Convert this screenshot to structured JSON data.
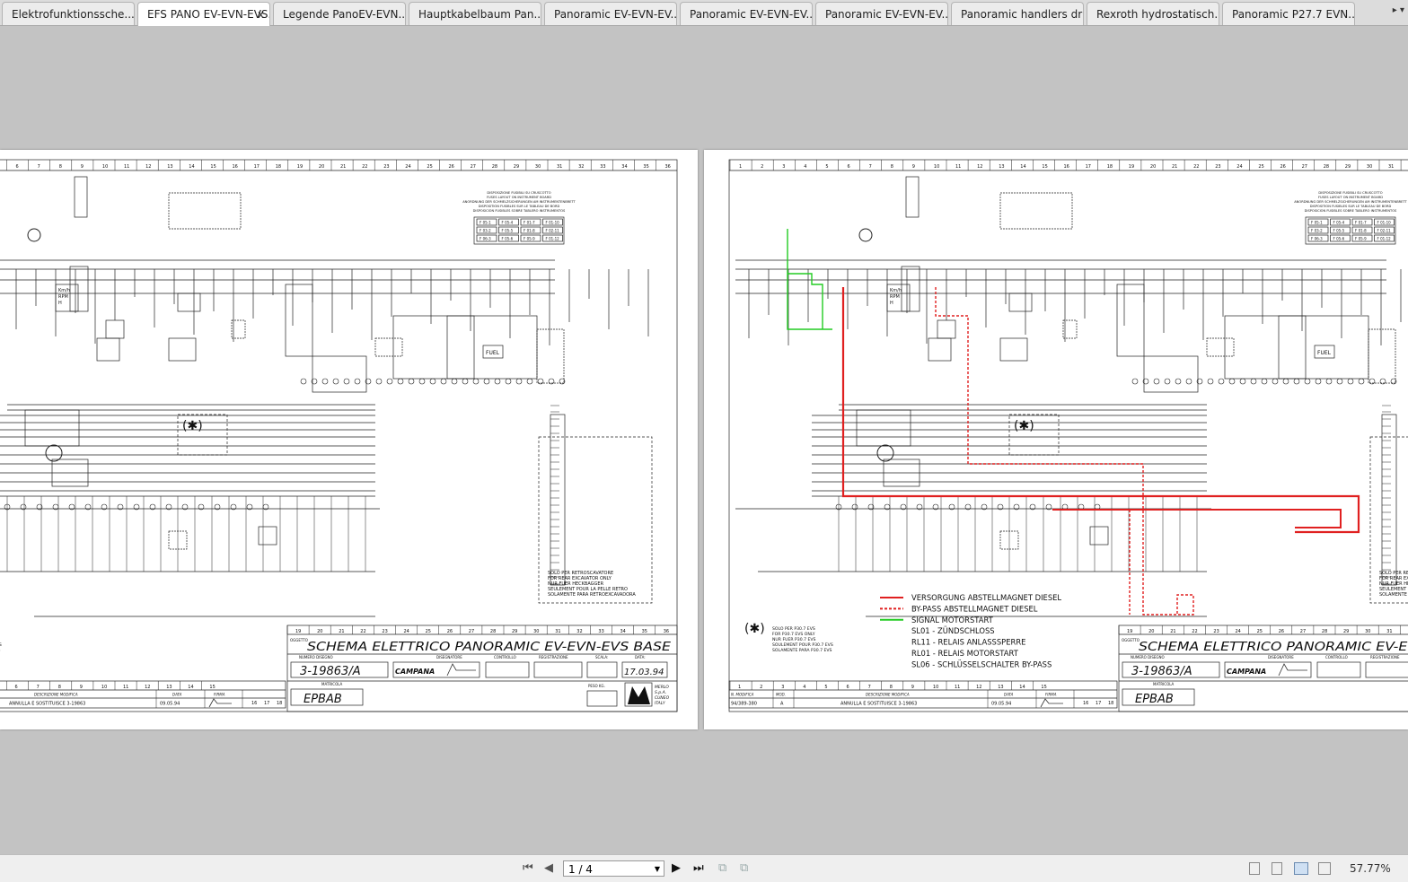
{
  "tabs": [
    {
      "label": "Elektrofunktionssche...",
      "active": false
    },
    {
      "label": "EFS PANO EV-EVN-EVS...",
      "active": true
    },
    {
      "label": "Legende PanoEV-EVN...",
      "active": false
    },
    {
      "label": "Hauptkabelbaum Pan...",
      "active": false
    },
    {
      "label": "Panoramic EV-EVN-EV...",
      "active": false
    },
    {
      "label": "Panoramic EV-EVN-EV...",
      "active": false
    },
    {
      "label": "Panoramic EV-EVN-EV...",
      "active": false
    },
    {
      "label": "Panoramic handlers dri...",
      "active": false
    },
    {
      "label": "Rexroth hydrostatisch...",
      "active": false
    },
    {
      "label": "Panoramic P27.7 EVN...",
      "active": false
    }
  ],
  "tab_close": "x",
  "tab_more": "▸ ▾",
  "toolbar": {
    "page_value": "1 / 4",
    "zoom": "57.77%"
  },
  "icons": {
    "first": "first-page-icon",
    "prev": "prev-page-icon",
    "next": "next-page-icon",
    "last": "last-page-icon"
  },
  "sheet": {
    "fuse_title": [
      "DISPOSIZIONE FUSIBILI SU CRUSCOTTO",
      "FUSES LAYOUT ON INSTRUMENT BOARD",
      "ANORDNUNG DER SCHMELZSICHERUNGEN AM INSTRUMENTENBRETT",
      "DISPOSITION FUSIBLES SUR LE TABLEAU DE BORD",
      "DISPOSICION FUSIBLES SOBRE TABLERO INSTRUMENTOS"
    ],
    "fuses": [
      "F 05-1",
      "F 05-4",
      "F 01-7",
      "F 01-10",
      "F 03-2",
      "F 05-5",
      "F 01-8",
      "F 02-11",
      "F 06-3",
      "F 05-6",
      "F 05-9",
      "F 01-12"
    ],
    "excavator_note": [
      "SOLO PER RETROSCAVATORE",
      "FOR REAR EXCAVATOR ONLY",
      "NUR FUER HECKBAGGER",
      "SEULEMENT POUR LA PELLE RETRO",
      "SOLAMENTE PARA RETROEXCAVADORA"
    ],
    "p30_note": [
      "SOLO PER P30.7 EVS",
      "FOR P30.7 EVS ONLY",
      "NUR FUER P30.7 EVS",
      "SOULEMENT POUR P30.7 EVS",
      "SOLAMENTE PARA P30.7 EVS"
    ],
    "asterisk": "(✱)",
    "fuel": "FUEL",
    "gauge": [
      "Km/h",
      "RPM",
      "H"
    ],
    "oggetto": "OGGETTO",
    "title": "SCHEMA ELETTRICO PANORAMIC EV-EVN-EVS BASE",
    "numero_label": "NUMERO DISEGNO",
    "numero": "3-19863/A",
    "disegnatore_label": "DISEGNATORE",
    "disegnatore": "CAMPANA",
    "controllo_label": "CONTROLLO",
    "registrazione_label": "REGISTRAZIONE",
    "scala_label": "SCALA:",
    "data_label": "DATA:",
    "data": "17.03.94",
    "matricola_label": "MATRICOLA",
    "matricola": "EPBAB",
    "peso_label": "PESO KG.",
    "company": [
      "MERLO",
      "S.p.A.",
      "CUNEO",
      "ITALY"
    ],
    "mod_headers": [
      "N. MODIFICA",
      "MOD.",
      "DESCRIZIONE MODIFICA",
      "DATA",
      "FIRMA"
    ],
    "mod_row": [
      "94/389-380",
      "A",
      "ANNULLA E SOSTITUISCE 3-19863",
      "09.05.94"
    ]
  },
  "legend": {
    "colors": {
      "supply": "#e02020",
      "bypass": "#e02020",
      "signal": "#22cc22"
    },
    "items": [
      "VERSORGUNG ABSTELLMAGNET DIESEL",
      "BY-PASS ABSTELLMAGNET DIESEL",
      "SIGNAL MOTORSTART",
      "SL01 - ZÜNDSCHLOSS",
      "RL11 - RELAIS ANLASSSPERRE",
      "RL01 - RELAIS MOTORSTART",
      "SL06 - SCHLÜSSELSCHALTER BY-PASS"
    ]
  }
}
